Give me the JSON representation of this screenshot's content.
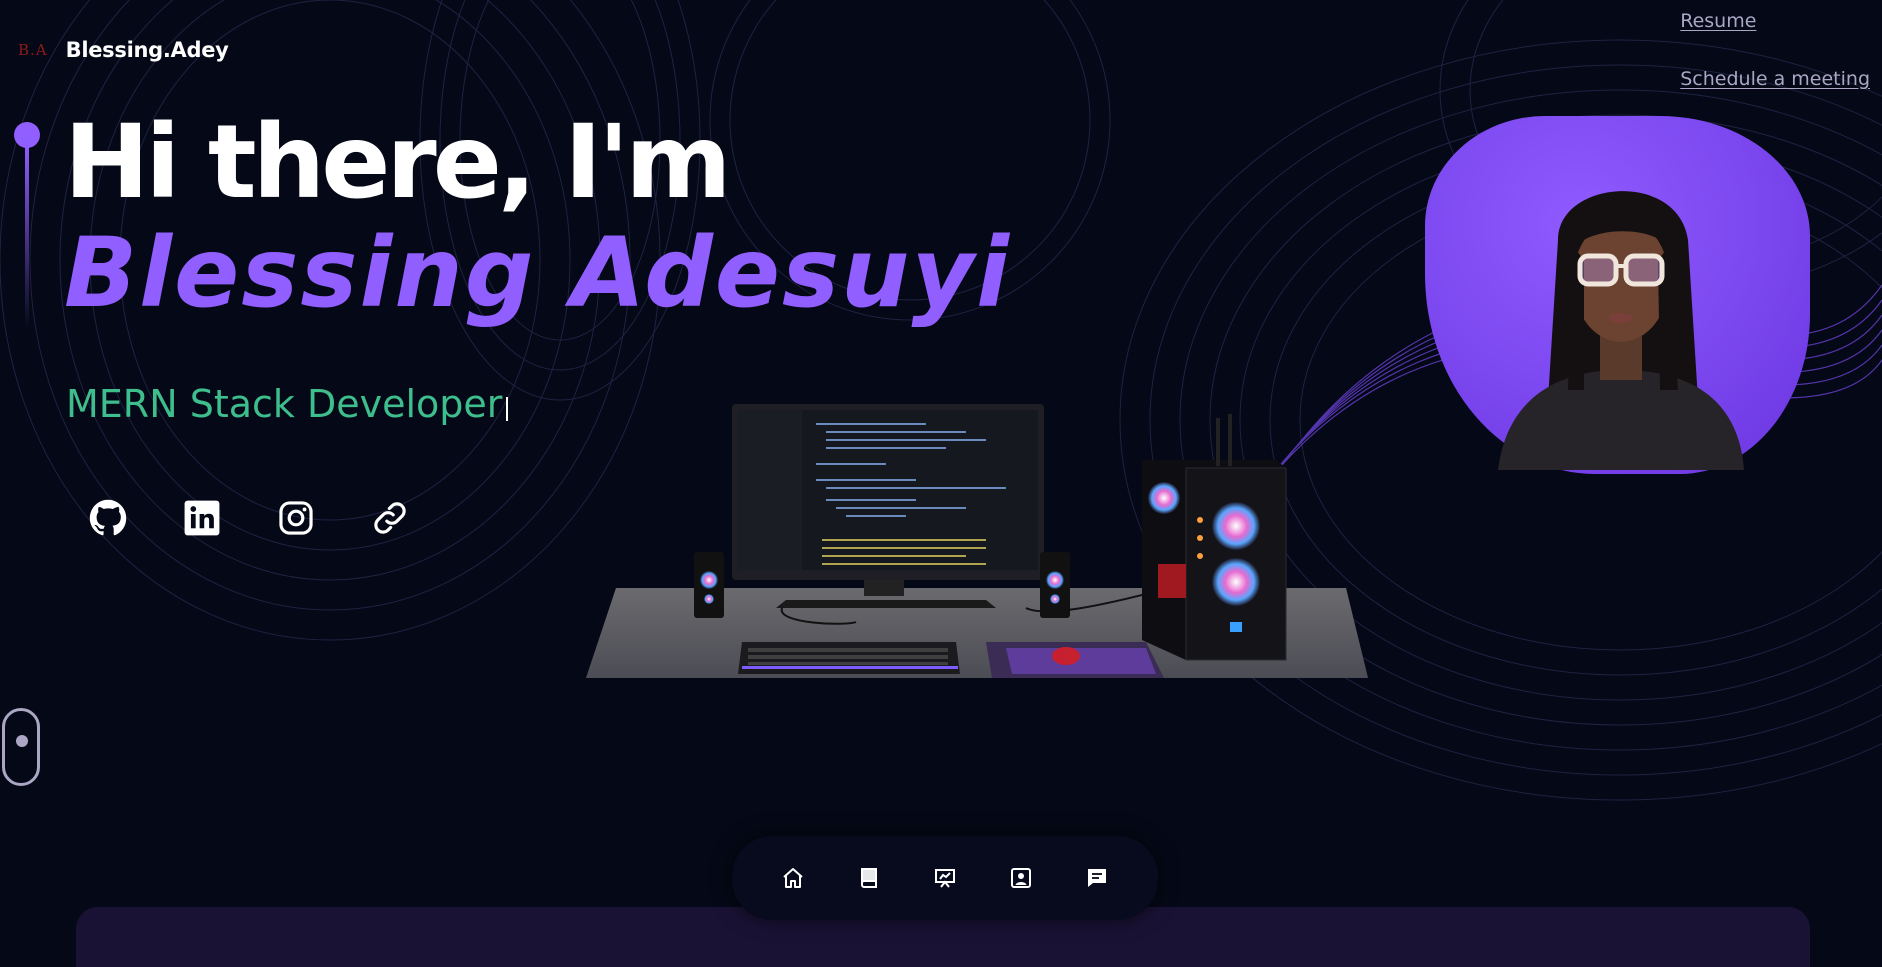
{
  "header": {
    "logo_mark": "B.A",
    "brand": "Blessing.Adey",
    "links": [
      {
        "label": "Resume"
      },
      {
        "label": "Schedule a meeting"
      }
    ]
  },
  "hero": {
    "greeting": "Hi there, I'm",
    "name": "Blessing Adesuyi",
    "role": "MERN Stack Developer"
  },
  "socials": [
    {
      "icon": "github-icon"
    },
    {
      "icon": "linkedin-icon"
    },
    {
      "icon": "instagram-icon"
    },
    {
      "icon": "link-icon"
    }
  ],
  "dock": [
    {
      "icon": "home-icon"
    },
    {
      "icon": "book-icon"
    },
    {
      "icon": "presentation-icon"
    },
    {
      "icon": "contact-card-icon"
    },
    {
      "icon": "message-icon"
    }
  ],
  "colors": {
    "background": "#050816",
    "accent": "#915eff",
    "role_green": "#3ebd8d",
    "muted_link": "#aaa6c3"
  }
}
